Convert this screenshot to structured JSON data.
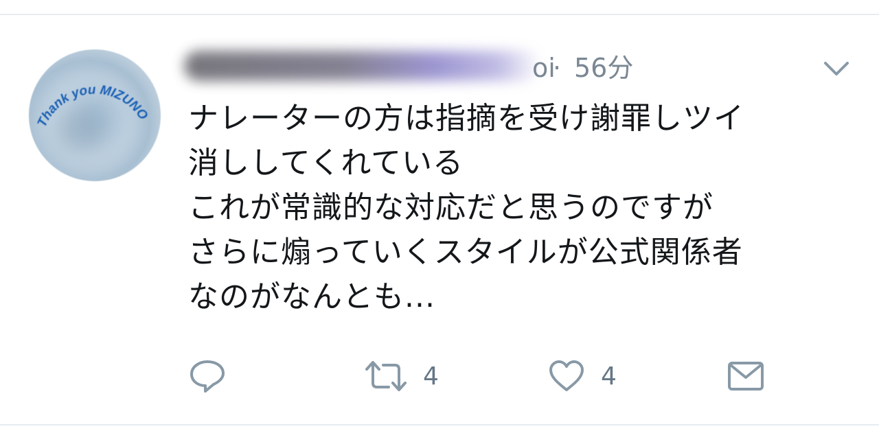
{
  "tweet": {
    "avatar_text": "Thank you MIZUNO",
    "handle_visible_suffix": "oi",
    "separator": "·",
    "time": "56分",
    "lines": [
      "ナレーターの方は指摘を受け謝罪しツイ",
      "消ししてくれている",
      "これが常識的な対応だと思うのですが",
      "さらに煽っていくスタイルが公式関係者",
      "なのがなんとも..."
    ]
  },
  "actions": {
    "reply": {
      "icon": "reply-icon"
    },
    "retweet": {
      "icon": "retweet-icon",
      "count": "4"
    },
    "like": {
      "icon": "heart-icon",
      "count": "4"
    },
    "dm": {
      "icon": "envelope-icon"
    }
  },
  "colors": {
    "text": "#14171a",
    "secondary": "#657786",
    "divider": "#e6ecf0",
    "avatar_ring_text": "#1a5fb4"
  }
}
